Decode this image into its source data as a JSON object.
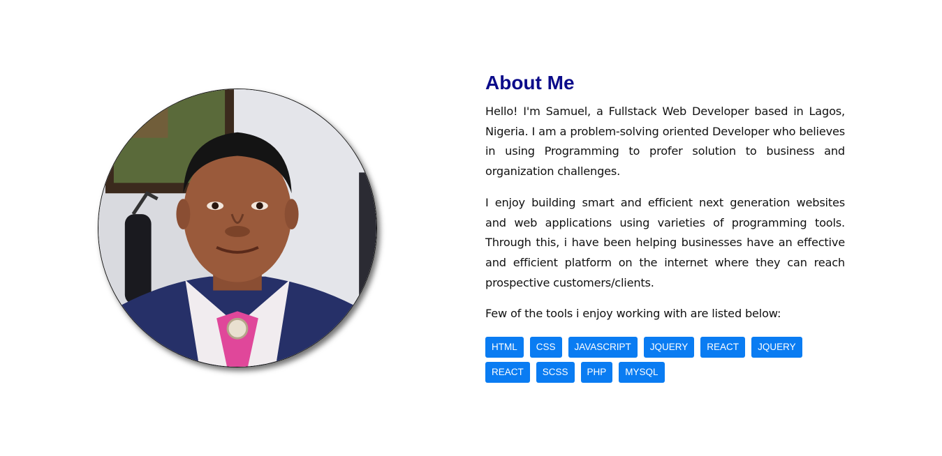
{
  "about": {
    "heading": "About Me",
    "paragraph_1": "Hello! I'm Samuel, a Fullstack Web Developer based in Lagos, Nigeria. I am a problem-solving oriented Developer who believes in using Programming to profer solution to business and organization challenges.",
    "paragraph_2": "I enjoy building smart and efficient next generation websites and web applications using varieties of programming tools. Through this, i have been helping businesses have an effective and efficient platform on the internet where they can reach prospective customers/clients.",
    "tools_intro": "Few of the tools i enjoy working with are listed below:",
    "tools": [
      "HTML",
      "CSS",
      "JAVASCRIPT",
      "JQUERY",
      "REACT",
      "JQUERY",
      "REACT",
      "SCSS",
      "PHP",
      "MYSQL"
    ]
  },
  "colors": {
    "heading": "#0b0b8a",
    "tag_background": "#0a7cf2",
    "tag_text": "#ffffff"
  }
}
